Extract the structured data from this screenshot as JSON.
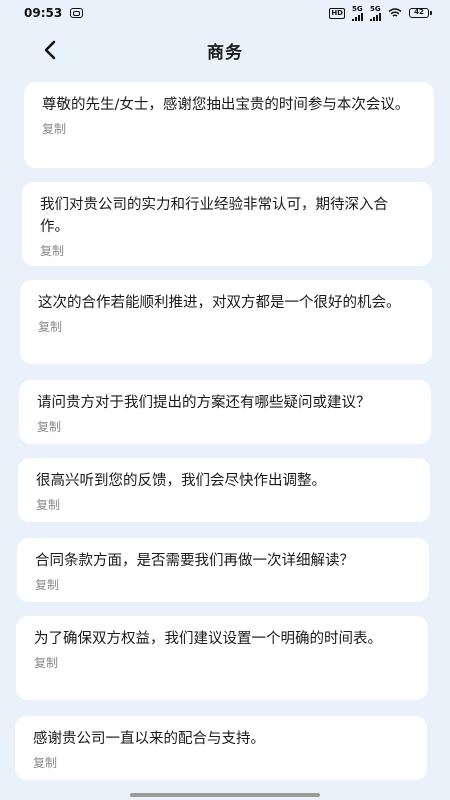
{
  "status_bar": {
    "time": "09:53",
    "hd_label": "HD",
    "signal1_label": "5G",
    "signal2_label": "5G",
    "battery_level": "42"
  },
  "header": {
    "title": "商务",
    "back_icon": "chevron-left-icon"
  },
  "phrases": [
    {
      "text": "尊敬的先生/女士，感谢您抽出宝贵的时间参与本次会议。",
      "copy_label": "复制"
    },
    {
      "text": "我们对贵公司的实力和行业经验非常认可，期待深入合作。",
      "copy_label": "复制"
    },
    {
      "text": "这次的合作若能顺利推进，对双方都是一个很好的机会。",
      "copy_label": "复制"
    },
    {
      "text": "请问贵方对于我们提出的方案还有哪些疑问或建议？",
      "copy_label": "复制"
    },
    {
      "text": "很高兴听到您的反馈，我们会尽快作出调整。",
      "copy_label": "复制"
    },
    {
      "text": "合同条款方面，是否需要我们再做一次详细解读？",
      "copy_label": "复制"
    },
    {
      "text": "为了确保双方权益，我们建议设置一个明确的时间表。",
      "copy_label": "复制"
    },
    {
      "text": "感谢贵公司一直以来的配合与支持。",
      "copy_label": "复制"
    }
  ]
}
